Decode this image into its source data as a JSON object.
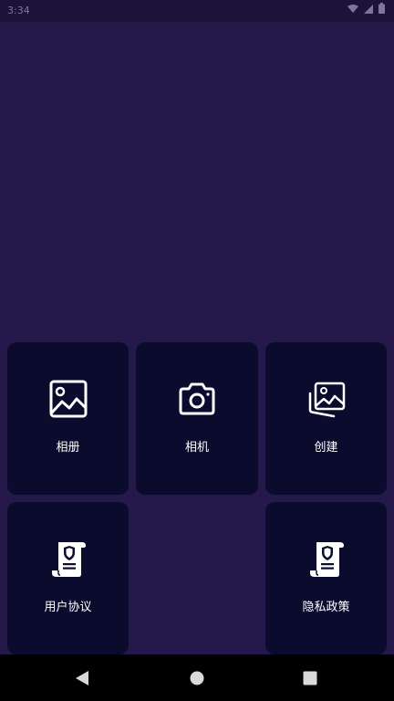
{
  "status_bar": {
    "time": "3:34"
  },
  "tiles": [
    {
      "label": "相册",
      "icon": "photo-icon"
    },
    {
      "label": "相机",
      "icon": "camera-icon"
    },
    {
      "label": "创建",
      "icon": "photos-stack-icon"
    },
    {
      "label": "用户协议",
      "icon": "agreement-scroll-icon"
    },
    {
      "label": "隐私政策",
      "icon": "privacy-scroll-icon"
    }
  ],
  "nav_bar": {
    "back": "back-triangle-icon",
    "home": "home-circle-icon",
    "recents": "recents-square-icon"
  },
  "colors": {
    "background": "#24194a",
    "tile": "#0b0b2e",
    "status_bar": "#1b1438",
    "nav_bar": "#000000"
  }
}
